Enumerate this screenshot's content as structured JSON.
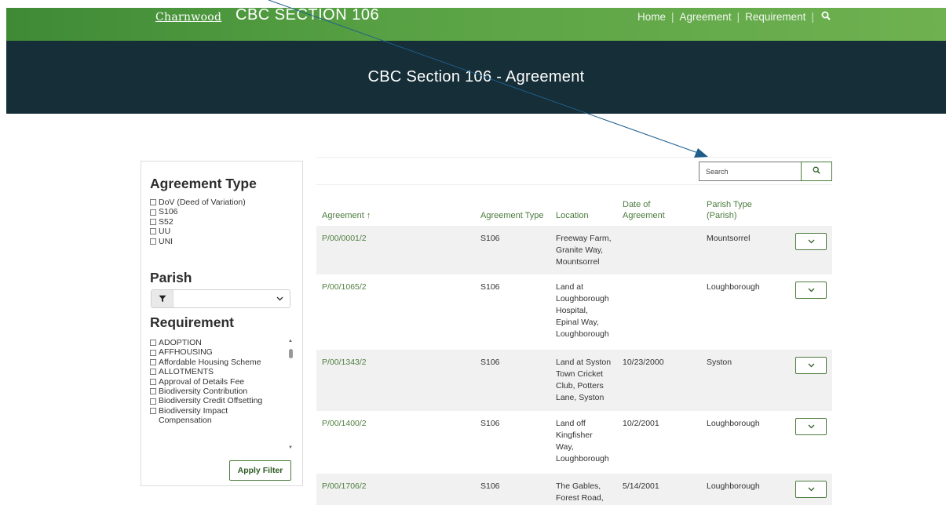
{
  "header": {
    "brand": "Charnwood",
    "site_title": "CBC SECTION 106",
    "nav": [
      "Home",
      "Agreement",
      "Requirement"
    ],
    "search_icon": "search-icon"
  },
  "hero": {
    "title": "CBC Section 106 - Agreement"
  },
  "filters": {
    "agreement_type": {
      "heading": "Agreement Type",
      "options": [
        "DoV (Deed of Variation)",
        "S106",
        "S52",
        "UU",
        "UNI"
      ]
    },
    "parish": {
      "heading": "Parish",
      "selected": ""
    },
    "requirement": {
      "heading": "Requirement",
      "options": [
        "ADOPTION",
        "AFFHOUSING",
        "Affordable Housing Scheme",
        "ALLOTMENTS",
        "Approval of Details Fee",
        "Biodiversity Contribution",
        "Biodiversity Credit Offsetting",
        "Biodiversity Impact",
        "Compensation"
      ]
    },
    "apply_label": "Apply Filter"
  },
  "table": {
    "search_placeholder": "Search",
    "columns": [
      "Agreement ↑",
      "Agreement Type",
      "Location",
      "Date of Agreement",
      "Parish Type (Parish)"
    ],
    "rows": [
      {
        "agreement": "P/00/0001/2",
        "type": "S106",
        "location": "Freeway Farm, Granite Way, Mountsorrel",
        "date": "",
        "parish": "Mountsorrel"
      },
      {
        "agreement": "P/00/1065/2",
        "type": "S106",
        "location": "Land at Loughborough Hospital, Epinal Way, Loughborough",
        "date": "",
        "parish": "Loughborough"
      },
      {
        "agreement": "P/00/1343/2",
        "type": "S106",
        "location": "Land at Syston Town Cricket Club, Potters Lane, Syston",
        "date": "10/23/2000",
        "parish": "Syston"
      },
      {
        "agreement": "P/00/1400/2",
        "type": "S106",
        "location": "Land off Kingfisher Way, Loughborough",
        "date": "10/2/2001",
        "parish": "Loughborough"
      },
      {
        "agreement": "P/00/1706/2",
        "type": "S106",
        "location": "The Gables, Forest Road,",
        "date": "5/14/2001",
        "parish": "Loughborough"
      }
    ]
  },
  "colors": {
    "green": "#4a7b3c",
    "hero": "#152e37",
    "annotation": "#1f5e8c"
  }
}
